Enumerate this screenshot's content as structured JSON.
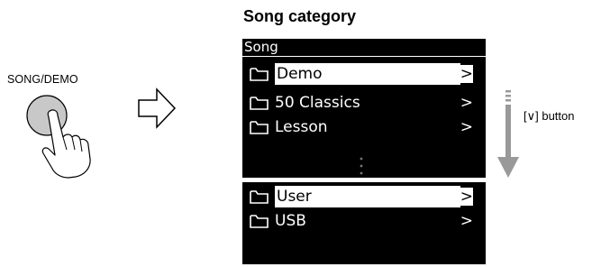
{
  "heading": "Song category",
  "button_label": "SONG/DEMO",
  "button_caption": "[∨] button",
  "screen_top": {
    "header": "Song",
    "rows": [
      {
        "label": "Demo",
        "chevron": ">",
        "selected": true
      },
      {
        "label": "50 Classics",
        "chevron": ">",
        "selected": false
      },
      {
        "label": "Lesson",
        "chevron": ">",
        "selected": false
      }
    ]
  },
  "screen_bottom": {
    "rows": [
      {
        "label": "User",
        "chevron": ">",
        "selected": true
      },
      {
        "label": "USB",
        "chevron": ">",
        "selected": false
      }
    ]
  },
  "icons": [
    "finger-press-icon",
    "arrow-right-icon",
    "folder-icon",
    "scroll-down-arrow-icon",
    "vertical-dots-icon"
  ],
  "colors": {
    "screen_bg": "#000000",
    "screen_text": "#ffffff",
    "button_fill": "#c8c8c8",
    "arrow_gray": "#999999"
  }
}
